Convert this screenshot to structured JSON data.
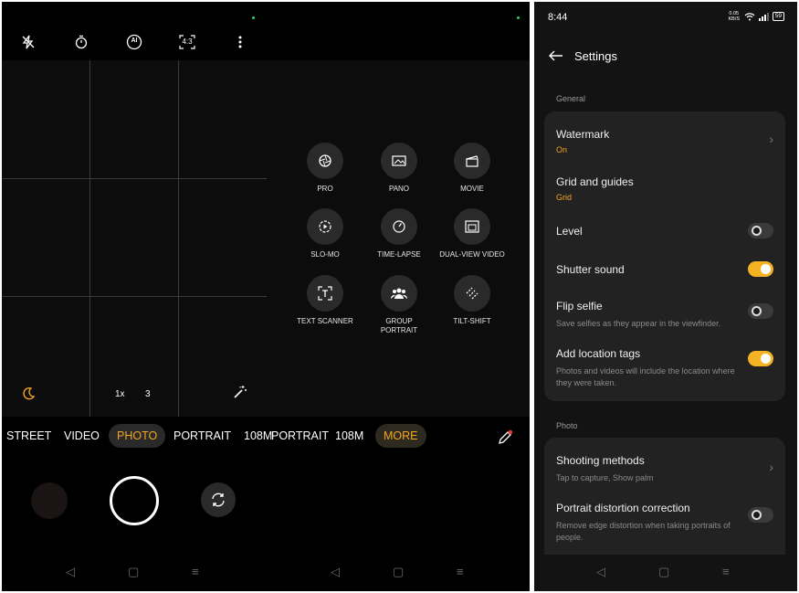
{
  "camera": {
    "modes": {
      "street": "STREET",
      "video": "VIDEO",
      "photo": "PHOTO",
      "portrait": "PORTRAIT",
      "m108": "108M"
    },
    "zoom": {
      "a": "1x",
      "b": "3"
    },
    "icons": [
      "flash-off-icon",
      "timer-icon",
      "ai-icon",
      "aspect-ratio-icon",
      "more-icon",
      "night-mode-icon",
      "magic-wand-icon",
      "edit-pencil-icon",
      "shutter-button",
      "switch-camera-icon"
    ],
    "aspect_label": "4:3",
    "ai_label": "AI"
  },
  "modes2": {
    "street": "108M",
    "portrait": "PORTRAIT",
    "m108": "108M",
    "more": "MORE"
  },
  "grid": [
    {
      "label": "PRO"
    },
    {
      "label": "PANO"
    },
    {
      "label": "MOVIE"
    },
    {
      "label": "SLO-MO"
    },
    {
      "label": "TIME-LAPSE"
    },
    {
      "label": "DUAL-VIEW VIDEO"
    },
    {
      "label": "TEXT SCANNER"
    },
    {
      "label": "GROUP PORTRAIT"
    },
    {
      "label": "TILT-SHIFT"
    }
  ],
  "settings": {
    "time": "8:44",
    "battery": "59",
    "speed": "0.05 KB/S",
    "title": "Settings",
    "section_general": "General",
    "section_photo": "Photo",
    "watermark": {
      "title": "Watermark",
      "value": "On"
    },
    "grid": {
      "title": "Grid and guides",
      "value": "Grid"
    },
    "level": {
      "title": "Level"
    },
    "shutter": {
      "title": "Shutter sound"
    },
    "flip": {
      "title": "Flip selfie",
      "desc": "Save selfies as they appear in the viewfinder."
    },
    "location": {
      "title": "Add location tags",
      "desc": "Photos and videos will include the location where they were taken."
    },
    "shooting": {
      "title": "Shooting methods",
      "desc": "Tap to capture, Show palm"
    },
    "distortion": {
      "title": "Portrait distortion correction",
      "desc": "Remove edge distortion when taking portraits of people."
    }
  },
  "colors": {
    "accent": "#f5a623",
    "toggle_on": "#f5b323",
    "card": "#222222"
  }
}
